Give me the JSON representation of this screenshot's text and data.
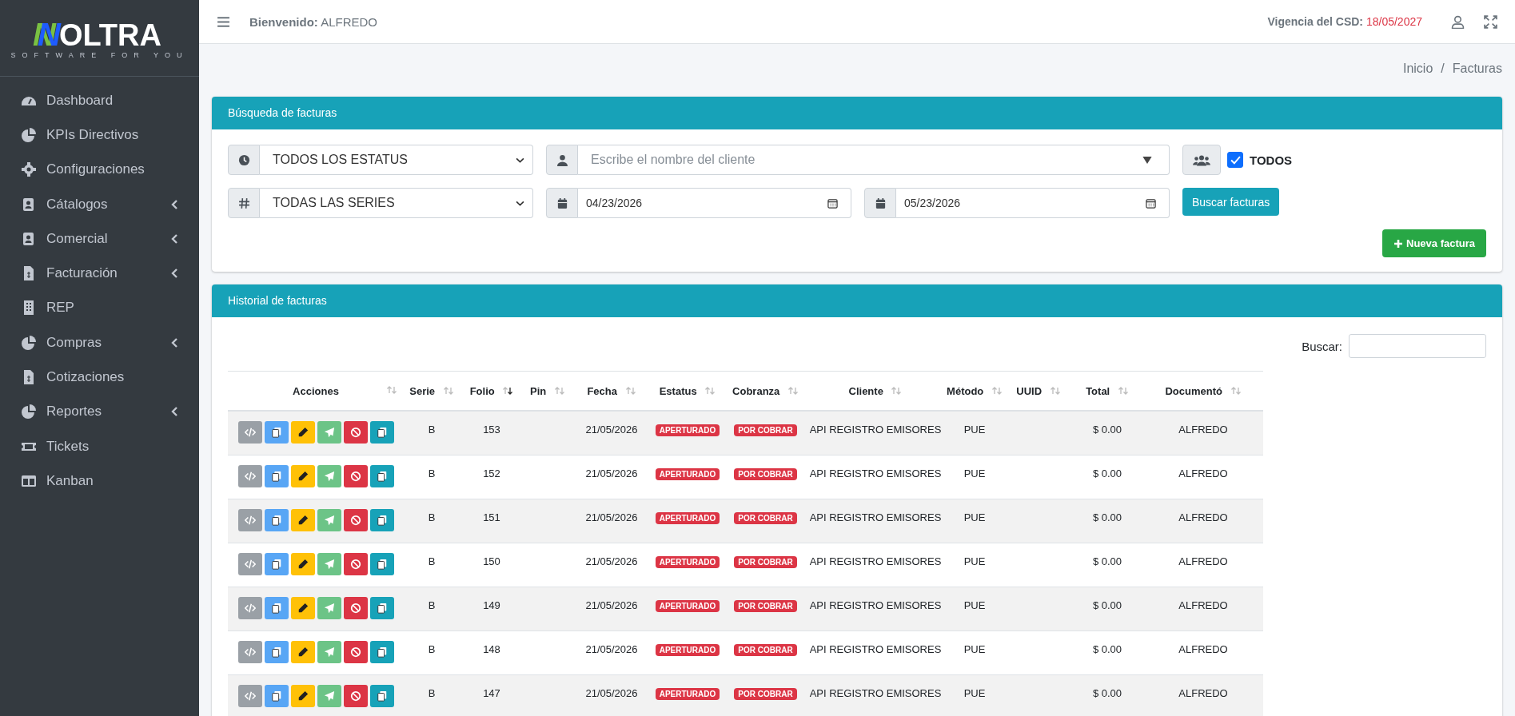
{
  "sidebar": {
    "logo": {
      "mark": "N",
      "word": "OLTRA",
      "tagline": "SOFTWARE FOR YOU"
    },
    "items": [
      {
        "label": "Dashboard",
        "has_submenu": false
      },
      {
        "label": "KPIs Directivos",
        "has_submenu": false
      },
      {
        "label": "Configuraciones",
        "has_submenu": false
      },
      {
        "label": "Cátalogos",
        "has_submenu": true
      },
      {
        "label": "Comercial",
        "has_submenu": true
      },
      {
        "label": "Facturación",
        "has_submenu": true
      },
      {
        "label": "REP",
        "has_submenu": false
      },
      {
        "label": "Compras",
        "has_submenu": true
      },
      {
        "label": "Cotizaciones",
        "has_submenu": false
      },
      {
        "label": "Reportes",
        "has_submenu": true
      },
      {
        "label": "Tickets",
        "has_submenu": false
      },
      {
        "label": "Kanban",
        "has_submenu": false
      }
    ]
  },
  "header": {
    "welcome_label": "Bienvenido:",
    "user": "ALFREDO",
    "csd_label": "Vigencia del CSD:",
    "csd_date": "18/05/2027"
  },
  "breadcrumb": {
    "items": [
      "Inicio",
      "Facturas"
    ],
    "separator": "/"
  },
  "search_panel": {
    "title": "Búsqueda de facturas",
    "status_select": "TODOS LOS ESTATUS",
    "client_field": {
      "placeholder": "Escribe el nombre del cliente"
    },
    "all_clients": {
      "label": "TODOS",
      "checked": true
    },
    "series_select": "TODAS LAS SERIES",
    "date_from": "04/23/2026",
    "date_to": "05/23/2026",
    "search_button": "Buscar facturas",
    "new_button": "Nueva factura"
  },
  "history_panel": {
    "title": "Historial de facturas",
    "search_label": "Buscar:",
    "table": {
      "columns": [
        {
          "label": "Acciones",
          "sorted": false
        },
        {
          "label": "Serie",
          "sorted": false
        },
        {
          "label": "Folio",
          "sorted": true
        },
        {
          "label": "Pin",
          "sorted": false
        },
        {
          "label": "Fecha",
          "sorted": false
        },
        {
          "label": "Estatus",
          "sorted": false
        },
        {
          "label": "Cobranza",
          "sorted": false
        },
        {
          "label": "Cliente",
          "sorted": false
        },
        {
          "label": "Método",
          "sorted": false
        },
        {
          "label": "UUID",
          "sorted": false
        },
        {
          "label": "Total",
          "sorted": false
        },
        {
          "label": "Documentó",
          "sorted": false
        }
      ],
      "rows": [
        {
          "serie": "B",
          "folio": "153",
          "fecha": "21/05/2026",
          "estatus": "APERTURADO",
          "cobranza": "POR COBRAR",
          "cliente": "API REGISTRO EMISORES",
          "metodo": "PUE",
          "total": "$ 0.00",
          "documento": "ALFREDO"
        },
        {
          "serie": "B",
          "folio": "152",
          "fecha": "21/05/2026",
          "estatus": "APERTURADO",
          "cobranza": "POR COBRAR",
          "cliente": "API REGISTRO EMISORES",
          "metodo": "PUE",
          "total": "$ 0.00",
          "documento": "ALFREDO"
        },
        {
          "serie": "B",
          "folio": "151",
          "fecha": "21/05/2026",
          "estatus": "APERTURADO",
          "cobranza": "POR COBRAR",
          "cliente": "API REGISTRO EMISORES",
          "metodo": "PUE",
          "total": "$ 0.00",
          "documento": "ALFREDO"
        },
        {
          "serie": "B",
          "folio": "150",
          "fecha": "21/05/2026",
          "estatus": "APERTURADO",
          "cobranza": "POR COBRAR",
          "cliente": "API REGISTRO EMISORES",
          "metodo": "PUE",
          "total": "$ 0.00",
          "documento": "ALFREDO"
        },
        {
          "serie": "B",
          "folio": "149",
          "fecha": "21/05/2026",
          "estatus": "APERTURADO",
          "cobranza": "POR COBRAR",
          "cliente": "API REGISTRO EMISORES",
          "metodo": "PUE",
          "total": "$ 0.00",
          "documento": "ALFREDO"
        },
        {
          "serie": "B",
          "folio": "148",
          "fecha": "21/05/2026",
          "estatus": "APERTURADO",
          "cobranza": "POR COBRAR",
          "cliente": "API REGISTRO EMISORES",
          "metodo": "PUE",
          "total": "$ 0.00",
          "documento": "ALFREDO"
        },
        {
          "serie": "B",
          "folio": "147",
          "fecha": "21/05/2026",
          "estatus": "APERTURADO",
          "cobranza": "POR COBRAR",
          "cliente": "API REGISTRO EMISORES",
          "metodo": "PUE",
          "total": "$ 0.00",
          "documento": "ALFREDO"
        }
      ]
    }
  }
}
